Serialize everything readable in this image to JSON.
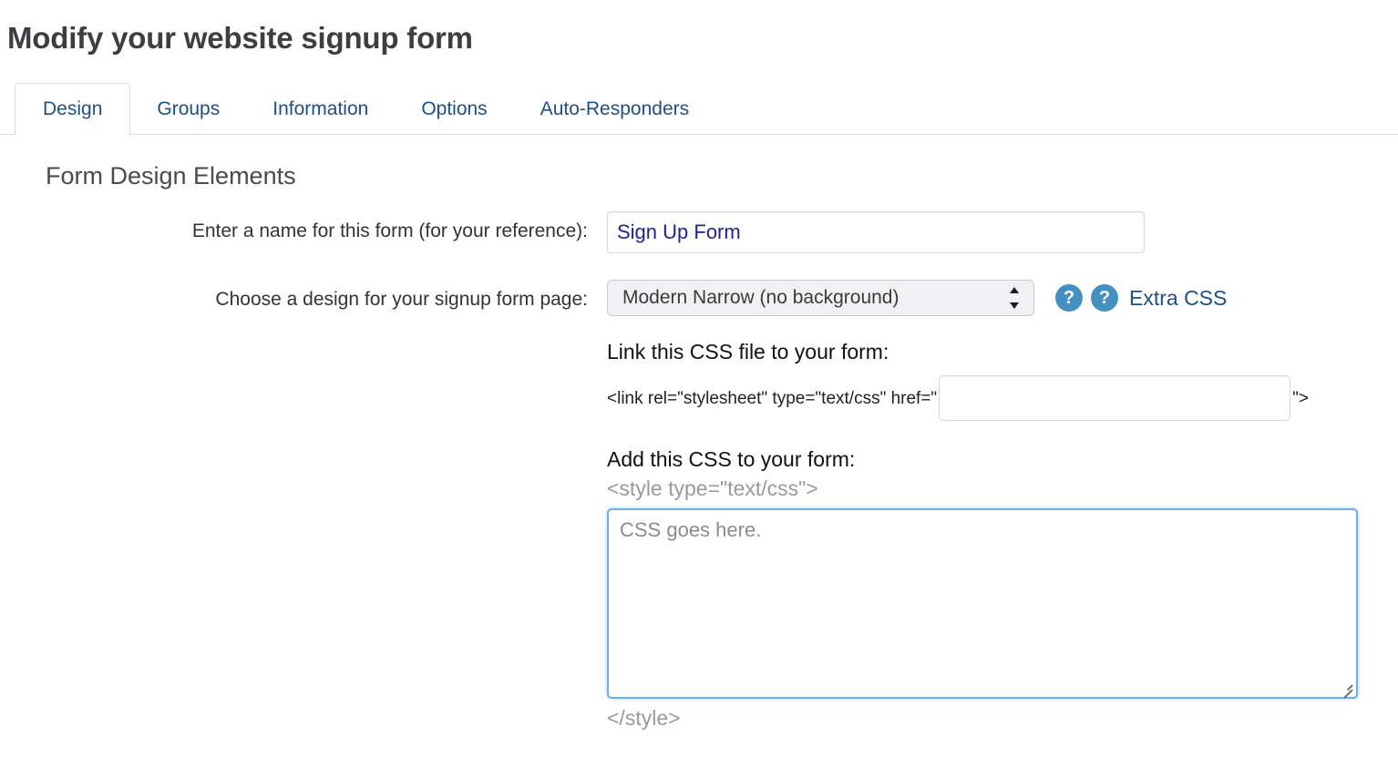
{
  "page": {
    "title": "Modify your website signup form"
  },
  "tabs": [
    {
      "label": "Design",
      "active": true
    },
    {
      "label": "Groups",
      "active": false
    },
    {
      "label": "Information",
      "active": false
    },
    {
      "label": "Options",
      "active": false
    },
    {
      "label": "Auto-Responders",
      "active": false
    }
  ],
  "section": {
    "title": "Form Design Elements"
  },
  "fields": {
    "form_name": {
      "label": "Enter a name for this form (for your reference):",
      "value": "Sign Up Form",
      "placeholder": ""
    },
    "design": {
      "label": "Choose a design for your signup form page:",
      "selected": "Modern Narrow (no background)",
      "options": [
        "Modern Narrow (no background)"
      ],
      "help_icon_1": "?",
      "help_icon_2": "?",
      "extra_css_link": "Extra CSS"
    }
  },
  "css_block": {
    "link_heading": "Link this CSS file to your form:",
    "link_code_prefix": "<link rel=\"stylesheet\" type=\"text/css\" href=\"",
    "link_code_suffix": "\">",
    "link_href_value": "",
    "link_href_placeholder": "",
    "add_heading": "Add this CSS to your form:",
    "style_open": "<style type=\"text/css\">",
    "style_close": "</style>",
    "textarea_value": "",
    "textarea_placeholder": "CSS goes here."
  },
  "colors": {
    "page_background": "#ffffff",
    "heading": "#3d3d42",
    "link_blue": "#205081",
    "input_text_navy": "#22228f",
    "help_icon_blue": "#4590c2",
    "textarea_focus_border": "#6cadea",
    "muted_gray": "#9a9a9a",
    "border_gray": "#dddddd"
  }
}
